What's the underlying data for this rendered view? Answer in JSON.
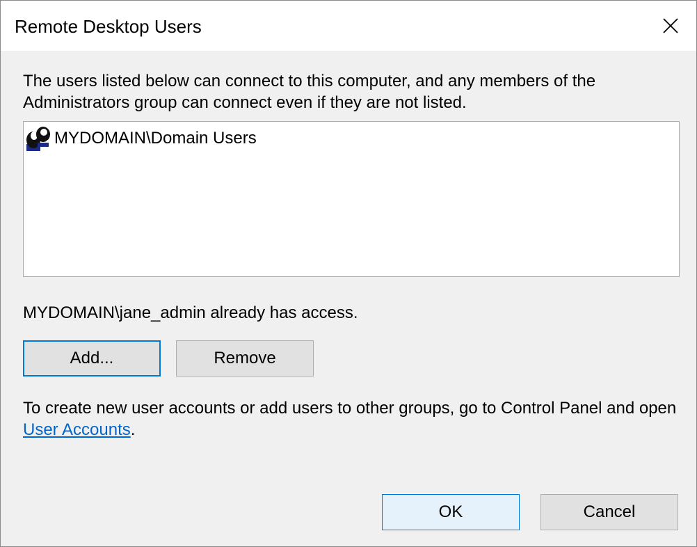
{
  "dialog": {
    "title": "Remote Desktop Users",
    "close_icon": "close-icon"
  },
  "intro_text": "The users listed below can connect to this computer, and any members of the Administrators group can connect even if they are not listed.",
  "user_list": {
    "items": [
      {
        "icon": "user-group-icon",
        "label": "MYDOMAIN\\Domain Users"
      }
    ]
  },
  "access_note": "MYDOMAIN\\jane_admin already has access.",
  "buttons": {
    "add_label": "Add...",
    "remove_label": "Remove",
    "ok_label": "OK",
    "cancel_label": "Cancel"
  },
  "help": {
    "text_before": "To create new user accounts or add users to other groups, go to Control Panel and open ",
    "link_label": "User Accounts",
    "text_after": "."
  },
  "colors": {
    "accent": "#0078d7",
    "link": "#0066cc",
    "dialog_bg": "#f0f0f0",
    "button_bg": "#e1e1e1",
    "default_button_bg": "#e5f1fb"
  }
}
